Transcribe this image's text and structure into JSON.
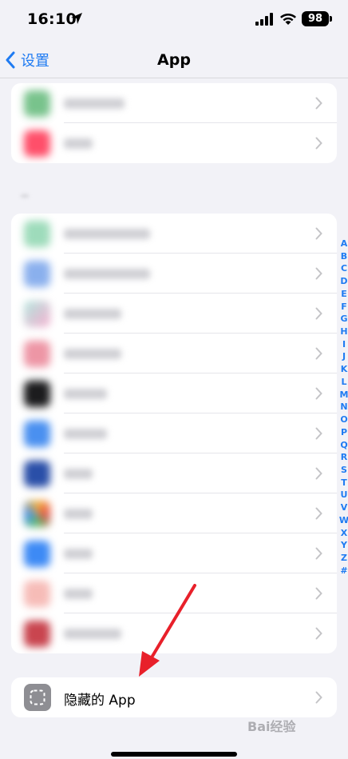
{
  "status_bar": {
    "time": "16:10",
    "battery": "98"
  },
  "nav": {
    "back_label": "设置",
    "title": "App"
  },
  "index_letters": [
    "A",
    "B",
    "C",
    "D",
    "E",
    "F",
    "G",
    "H",
    "I",
    "J",
    "K",
    "L",
    "M",
    "N",
    "O",
    "P",
    "Q",
    "R",
    "S",
    "T",
    "U",
    "V",
    "W",
    "X",
    "Y",
    "Z",
    "#"
  ],
  "hidden_apps": {
    "label": "隐藏的 App"
  },
  "watermark": "Bai经验",
  "colors": {
    "accent": "#1f7bf2",
    "arrow": "#e8202a"
  }
}
